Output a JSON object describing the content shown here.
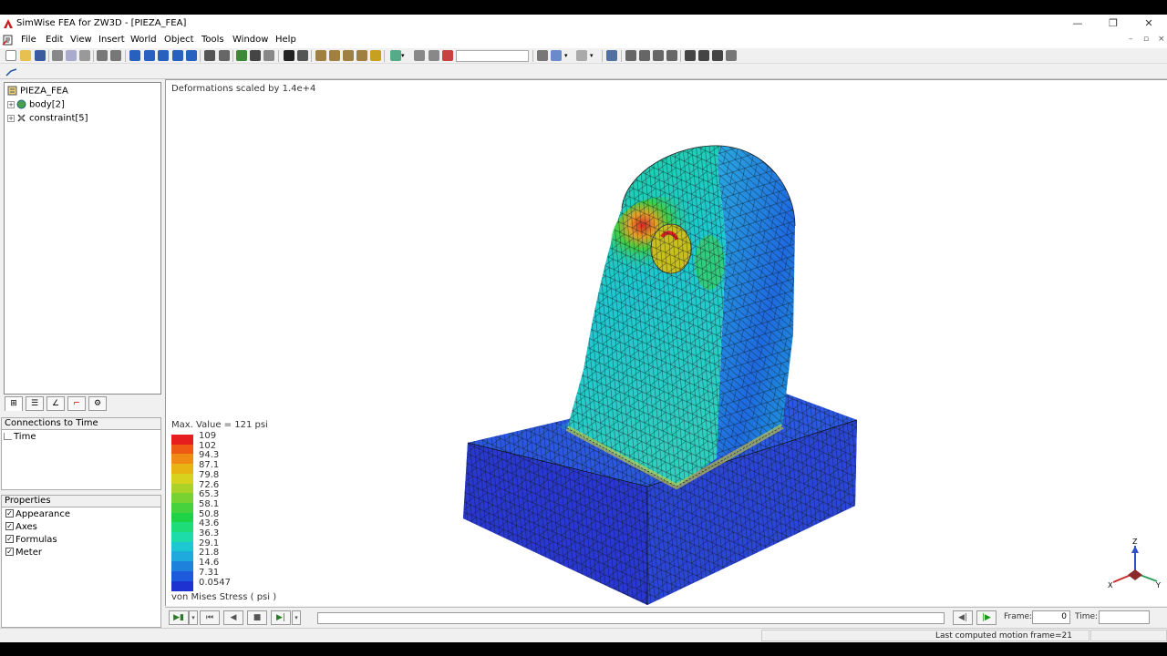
{
  "window": {
    "title": "SimWise FEA for ZW3D - [PIEZA_FEA]",
    "controls": [
      "—",
      "❐",
      "✕"
    ]
  },
  "menu": [
    "File",
    "Edit",
    "View",
    "Insert",
    "World",
    "Object",
    "Tools",
    "Window",
    "Help"
  ],
  "tree": {
    "root": "PIEZA_FEA",
    "items": [
      "body[2]",
      "constraint[5]"
    ]
  },
  "connections": {
    "header": "Connections to Time",
    "item": "Time"
  },
  "properties": {
    "header": "Properties",
    "items": [
      "Appearance",
      "Axes",
      "Formulas",
      "Meter"
    ]
  },
  "viewport": {
    "caption": "Deformations scaled by 1.4e+4",
    "legend": {
      "title": "Max. Value = 121 psi",
      "quantity": "von Mises Stress  ( psi )",
      "labels": [
        "109",
        "102",
        "94.3",
        "87.1",
        "79.8",
        "72.6",
        "65.3",
        "58.1",
        "50.8",
        "43.6",
        "36.3",
        "29.1",
        "21.8",
        "14.6",
        "7.31",
        "0.0547"
      ],
      "colors": [
        "#e61e1e",
        "#ee5a14",
        "#f08c14",
        "#e8b414",
        "#d6d21e",
        "#aad228",
        "#78d232",
        "#46d23c",
        "#1ed246",
        "#1edc78",
        "#1edcaa",
        "#1ec8d2",
        "#1eaadc",
        "#1e82dc",
        "#1e5adc",
        "#1e32d2"
      ]
    },
    "axes": {
      "z": "Z",
      "x": "X",
      "y": "Y"
    }
  },
  "playback": {
    "frame_label": "Frame:",
    "frame_value": "0",
    "time_label": "Time:",
    "time_value": ""
  },
  "status": {
    "text": "Last computed motion frame=21"
  }
}
